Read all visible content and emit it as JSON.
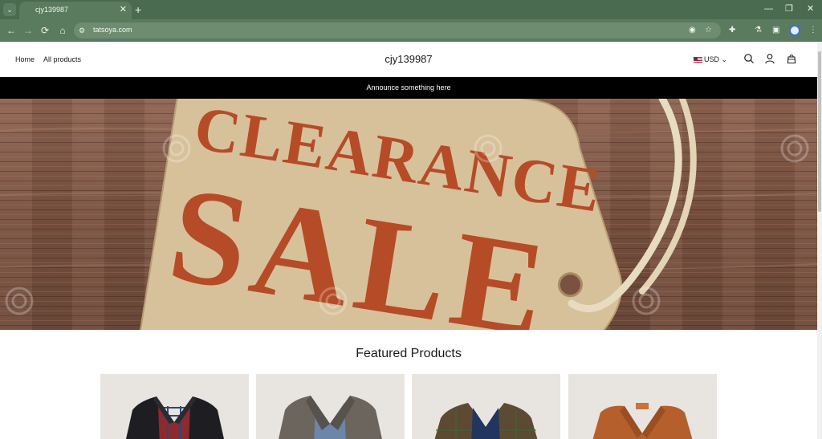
{
  "browser": {
    "tab_title": "cjy139987",
    "tab_close": "✕",
    "new_tab": "+",
    "url": "tatsoya.com",
    "window_controls": [
      "—",
      "❐",
      "✕"
    ]
  },
  "site": {
    "nav": [
      "Home",
      "All products"
    ],
    "store_name": "cjy139987",
    "currency": "USD",
    "currency_chevron": "⌄",
    "announcement": "Announce something here",
    "hero": {
      "tag_line1": "CLEARANCE",
      "tag_line2": "SALE",
      "tag_color": "#d7c19b",
      "text_color": "#b54c27"
    },
    "featured_title": "Featured Products",
    "products": [
      {
        "icon": "black-vest-image"
      },
      {
        "icon": "gray-tweed-vest-image"
      },
      {
        "icon": "brown-plaid-vest-image"
      },
      {
        "icon": "orange-leather-vest-image"
      }
    ]
  },
  "icons": [
    "search-icon",
    "account-icon",
    "cart-icon"
  ]
}
